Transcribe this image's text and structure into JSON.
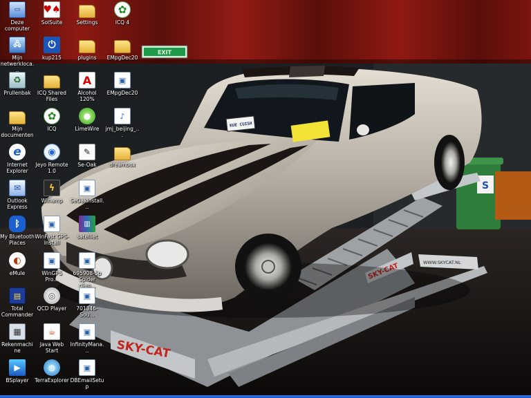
{
  "desktop": {
    "icons": [
      {
        "label": "Deze computer"
      },
      {
        "label": "SolSuite"
      },
      {
        "label": "Settings"
      },
      {
        "label": "ICQ 4"
      },
      {
        "label": "Mijn netwerkloca..."
      },
      {
        "label": "kup215"
      },
      {
        "label": "plugins"
      },
      {
        "label": "EMpgDec20"
      },
      {
        "label": "Prullenbak"
      },
      {
        "label": "ICQ Shared Files"
      },
      {
        "label": "Alcohol 120%"
      },
      {
        "label": "EMpgDec20"
      },
      {
        "label": "Mijn documenten"
      },
      {
        "label": "ICQ"
      },
      {
        "label": "LimeWire"
      },
      {
        "label": "jmj_beijing_..."
      },
      {
        "label": "Internet Explorer"
      },
      {
        "label": "Jeyo Remote 1.0"
      },
      {
        "label": "Se-Oak"
      },
      {
        "label": "dreambox"
      },
      {
        "label": "Outlook Express"
      },
      {
        "label": "Winamp"
      },
      {
        "label": "SeOakInstall..."
      },
      {
        "label": "My Bluetooth Places"
      },
      {
        "label": "WinFast GPS-Install"
      },
      {
        "label": "satelliet"
      },
      {
        "label": "eMule"
      },
      {
        "label": "WinGPS Pro..."
      },
      {
        "label": "695908-Sp Spider clien..."
      },
      {
        "label": "Total Commander"
      },
      {
        "label": "QCD Player"
      },
      {
        "label": "701346-Sou..."
      },
      {
        "label": "Rekenmachine"
      },
      {
        "label": "Java Web Start"
      },
      {
        "label": "InfinityMana..."
      },
      {
        "label": "BSplayer"
      },
      {
        "label": "TerraExplorer"
      },
      {
        "label": "DBEmailSetup"
      }
    ]
  },
  "wallpaper": {
    "car_plate": "KUE CUISH",
    "lift_brand": "SKY-CAT",
    "lift_url": "WWW.SKYCAT.NL",
    "exit_sign": "EXIT",
    "bin_letter": "S"
  },
  "colors": {
    "curtain": "#7a1410",
    "car_body": "#b7b0a6",
    "stripe": "#1b1513",
    "lift_metal": "#a9adb1",
    "lift_brand": "#c0271d",
    "bin": "#2f7d3a",
    "taskbar": "#2a63d8"
  }
}
